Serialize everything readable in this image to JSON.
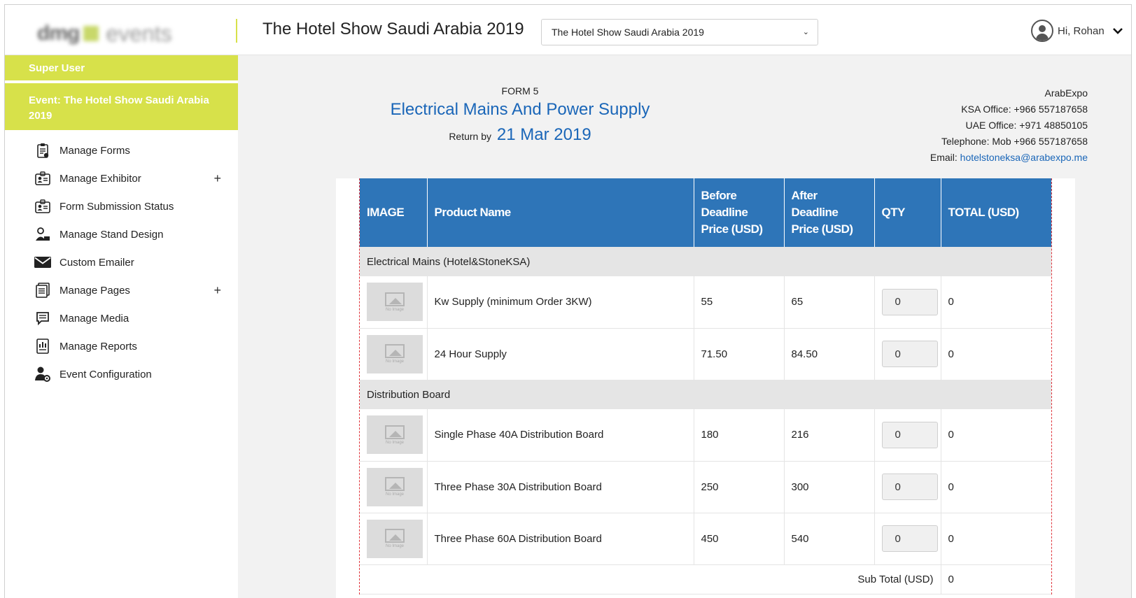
{
  "header": {
    "logo_text_1": "dmg",
    "logo_text_2": "events",
    "event_title": "The Hotel Show Saudi Arabia 2019",
    "event_select_value": "The Hotel Show Saudi Arabia 2019",
    "user_greeting": "Hi, Rohan"
  },
  "sidebar": {
    "role": "Super User",
    "event_label": "Event: The Hotel Show Saudi Arabia 2019",
    "items": [
      {
        "label": "Manage Forms",
        "icon": "clipboard-list-icon",
        "expandable": false
      },
      {
        "label": "Manage Exhibitor",
        "icon": "id-badge-icon",
        "expandable": true
      },
      {
        "label": "Form Submission Status",
        "icon": "id-badge-icon",
        "expandable": false
      },
      {
        "label": "Manage Stand Design",
        "icon": "user-desk-icon",
        "expandable": false
      },
      {
        "label": "Custom Emailer",
        "icon": "envelope-icon",
        "expandable": false
      },
      {
        "label": "Manage Pages",
        "icon": "pages-icon",
        "expandable": true
      },
      {
        "label": "Manage Media",
        "icon": "comment-icon",
        "expandable": false
      },
      {
        "label": "Manage Reports",
        "icon": "report-icon",
        "expandable": false
      },
      {
        "label": "Event Configuration",
        "icon": "user-gear-icon",
        "expandable": false
      }
    ]
  },
  "form": {
    "number": "FORM 5",
    "title": "Electrical Mains And Power Supply",
    "return_by_label": "Return by",
    "return_by_date": "21 Mar 2019"
  },
  "contact": {
    "company": "ArabExpo",
    "ksa_office": "KSA Office: +966 557187658",
    "uae_office": "UAE Office: +971 48850105",
    "telephone": "Telephone: Mob +966 557187658",
    "email_label": "Email:",
    "email": "hotelstoneksa@arabexpo.me"
  },
  "table": {
    "columns": [
      "IMAGE",
      "Product Name",
      "Before Deadline Price (USD)",
      "After Deadline Price (USD)",
      "QTY",
      "TOTAL (USD)"
    ],
    "no_image_text": "No Image",
    "categories": [
      {
        "name": "Electrical Mains (Hotel&StoneKSA)",
        "products": [
          {
            "name": "Kw Supply (minimum Order 3KW)",
            "before": "55",
            "after": "65",
            "qty": "0",
            "total": "0"
          },
          {
            "name": "24 Hour Supply",
            "before": "71.50",
            "after": "84.50",
            "qty": "0",
            "total": "0"
          }
        ]
      },
      {
        "name": "Distribution Board",
        "products": [
          {
            "name": "Single Phase 40A Distribution Board",
            "before": "180",
            "after": "216",
            "qty": "0",
            "total": "0"
          },
          {
            "name": "Three Phase 30A Distribution Board",
            "before": "250",
            "after": "300",
            "qty": "0",
            "total": "0"
          },
          {
            "name": "Three Phase 60A Distribution Board",
            "before": "450",
            "after": "540",
            "qty": "0",
            "total": "0"
          }
        ]
      }
    ],
    "subtotal_label": "Sub Total (USD)",
    "subtotal_value": "0"
  },
  "colors": {
    "accent_lime": "#d7e14a",
    "header_blue": "#2e75b8",
    "title_blue": "#1a66b8"
  }
}
